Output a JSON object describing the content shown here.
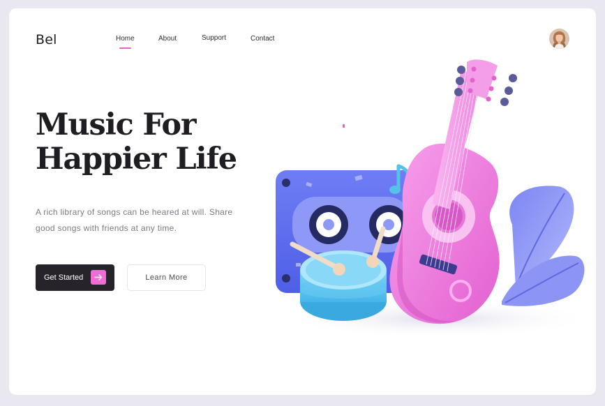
{
  "brand": {
    "name": "Bel"
  },
  "nav": {
    "items": [
      {
        "label": "Home",
        "active": true
      },
      {
        "label": "About",
        "active": false
      },
      {
        "label": "Support",
        "active": false
      },
      {
        "label": "Contact",
        "active": false
      }
    ]
  },
  "user": {
    "avatar_icon": "user-avatar"
  },
  "hero": {
    "headline_line1": "Music For",
    "headline_line2": "Happier Life",
    "description_line1": "A rich library of songs can be heared at will. Share",
    "description_line2": "good songs with friends at any time.",
    "primary_button": {
      "label": "Get Started",
      "icon": "arrow-right-icon"
    },
    "secondary_button": {
      "label": "Learn More"
    }
  },
  "illustration": {
    "items": [
      "cassette-tape",
      "drum",
      "drumsticks",
      "guitar",
      "music-note",
      "leaves"
    ]
  },
  "colors": {
    "accent": "#f06dd6",
    "dark": "#27232a",
    "text": "#1f1d22",
    "muted": "#7b7a81",
    "background": "#e9e8f1"
  }
}
